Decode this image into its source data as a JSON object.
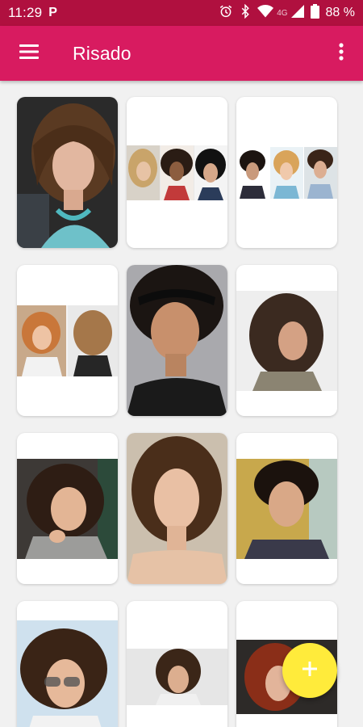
{
  "status_bar": {
    "time": "11:29",
    "app_indicator": "P",
    "network": "4G",
    "battery": "88 %",
    "icons": [
      "alarm-icon",
      "bluetooth-icon",
      "wifi-icon",
      "signal-icon",
      "battery-icon"
    ]
  },
  "app_bar": {
    "title": "Risado",
    "menu_icon": "hamburger-menu-icon",
    "overflow_icon": "more-vert-icon"
  },
  "colors": {
    "status_bar": "#b0103f",
    "app_bar": "#d81b60",
    "fab": "#ffeb3b",
    "background": "#f1f1f1"
  },
  "gallery": {
    "items": [
      {
        "name": "curly-bangs-portrait"
      },
      {
        "name": "three-curly-styles-collage"
      },
      {
        "name": "three-short-curly-collage"
      },
      {
        "name": "curly-bob-front-back-collage"
      },
      {
        "name": "tight-curls-headband"
      },
      {
        "name": "curly-lob-side-view"
      },
      {
        "name": "curly-bob-smiling"
      },
      {
        "name": "curly-shoulder-length-portrait"
      },
      {
        "name": "curly-pixie-cut"
      },
      {
        "name": "curly-bob-with-glasses"
      },
      {
        "name": "curly-shag-collage"
      },
      {
        "name": "red-curly-hair"
      }
    ]
  },
  "fab": {
    "label": "+",
    "icon": "plus-icon"
  }
}
